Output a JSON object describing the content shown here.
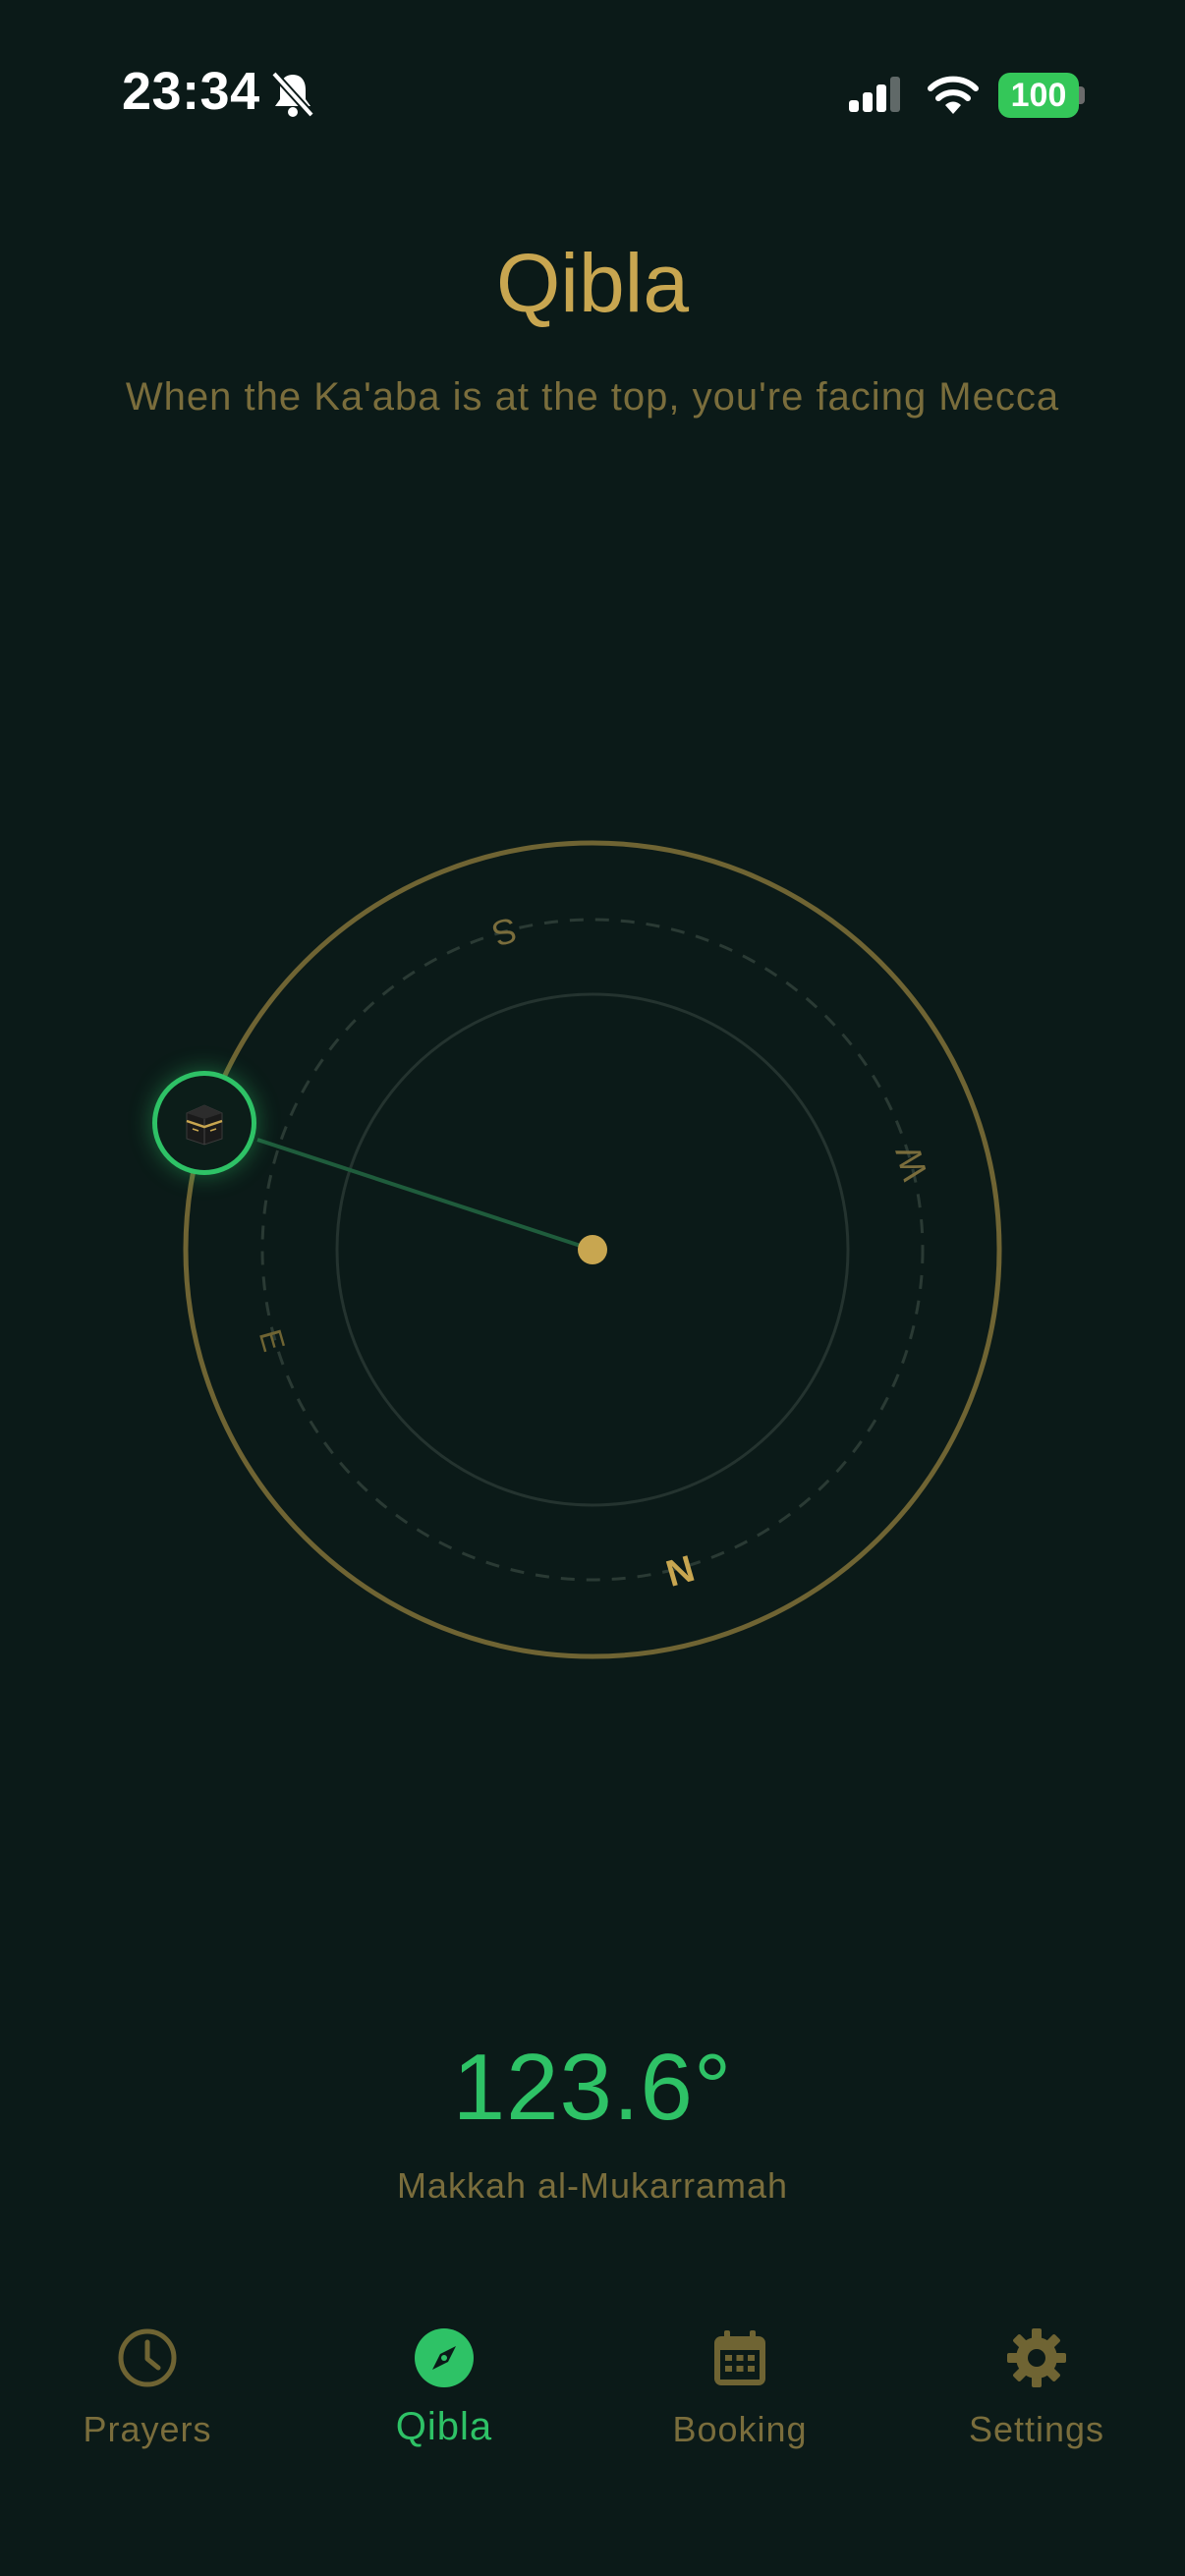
{
  "status_bar": {
    "time": "23:34",
    "battery": "100"
  },
  "header": {
    "title": "Qibla",
    "subtitle": "When the Ka'aba is at the top, you're facing Mecca"
  },
  "compass": {
    "directions": {
      "north": "N",
      "east": "E",
      "south": "S",
      "west": "W"
    },
    "kaaba_icon": "kaaba-icon"
  },
  "reading": {
    "degree": "123.6°",
    "location": "Makkah al-Mukarramah"
  },
  "tabs": [
    {
      "label": "Prayers",
      "icon": "clock-icon",
      "active": false
    },
    {
      "label": "Qibla",
      "icon": "compass-icon",
      "active": true
    },
    {
      "label": "Booking",
      "icon": "calendar-icon",
      "active": false
    },
    {
      "label": "Settings",
      "icon": "gear-icon",
      "active": false
    }
  ],
  "colors": {
    "background": "#0b1a18",
    "gold": "#c8a650",
    "muted_gold": "#7a6d3c",
    "accent_green": "#2ec266"
  }
}
